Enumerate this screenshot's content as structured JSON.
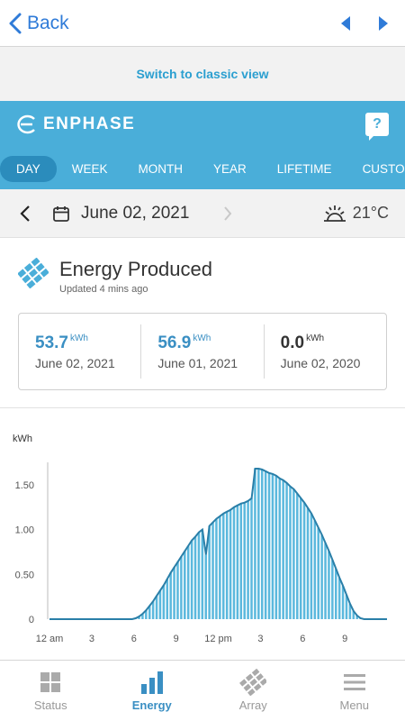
{
  "topbar": {
    "back_label": "Back"
  },
  "classic_link": "Switch to classic view",
  "brand": {
    "name": "ENPHASE",
    "help": "?"
  },
  "tabs": [
    {
      "label": "DAY",
      "active": true
    },
    {
      "label": "WEEK"
    },
    {
      "label": "MONTH"
    },
    {
      "label": "YEAR"
    },
    {
      "label": "LIFETIME"
    },
    {
      "label": "CUSTOM"
    }
  ],
  "date_bar": {
    "date": "June 02, 2021",
    "temperature": "21°C"
  },
  "energy": {
    "title": "Energy Produced",
    "updated": "Updated 4 mins ago"
  },
  "cards": [
    {
      "value": "53.7",
      "unit": "kWh",
      "date": "June 02, 2021"
    },
    {
      "value": "56.9",
      "unit": "kWh",
      "date": "June 01, 2021"
    },
    {
      "value": "0.0",
      "unit": "kWh",
      "date": "June 02, 2020"
    }
  ],
  "chart_data": {
    "type": "bar",
    "ylabel": "kWh",
    "ylim": [
      0,
      1.75
    ],
    "yticks": [
      "0",
      "0.50",
      "1.00",
      "1.50"
    ],
    "xticks": [
      "12 am",
      "3",
      "6",
      "9",
      "12 pm",
      "3",
      "6",
      "9"
    ],
    "values": [
      0,
      0,
      0,
      0,
      0,
      0,
      0,
      0,
      0,
      0,
      0,
      0,
      0,
      0,
      0,
      0,
      0,
      0,
      0,
      0,
      0,
      0,
      0,
      0,
      0.01,
      0.03,
      0.06,
      0.1,
      0.15,
      0.2,
      0.26,
      0.32,
      0.38,
      0.45,
      0.52,
      0.58,
      0.64,
      0.7,
      0.76,
      0.82,
      0.88,
      0.92,
      0.97,
      1.0,
      0.72,
      1.04,
      1.08,
      1.12,
      1.15,
      1.18,
      1.2,
      1.22,
      1.25,
      1.27,
      1.29,
      1.3,
      1.32,
      1.35,
      1.68,
      1.68,
      1.67,
      1.65,
      1.63,
      1.62,
      1.6,
      1.57,
      1.55,
      1.52,
      1.48,
      1.45,
      1.4,
      1.35,
      1.3,
      1.24,
      1.18,
      1.1,
      1.02,
      0.94,
      0.85,
      0.76,
      0.66,
      0.56,
      0.46,
      0.37,
      0.27,
      0.17,
      0.09,
      0.04,
      0.01,
      0,
      0,
      0,
      0,
      0,
      0,
      0
    ],
    "grid": false,
    "series_color": "#5bb8dd"
  },
  "bottom_nav": [
    {
      "label": "Status",
      "icon": "grid-icon",
      "active": false
    },
    {
      "label": "Energy",
      "icon": "bar-chart-icon",
      "active": true
    },
    {
      "label": "Array",
      "icon": "solar-array-icon",
      "active": false
    },
    {
      "label": "Menu",
      "icon": "hamburger-icon",
      "active": false
    }
  ]
}
